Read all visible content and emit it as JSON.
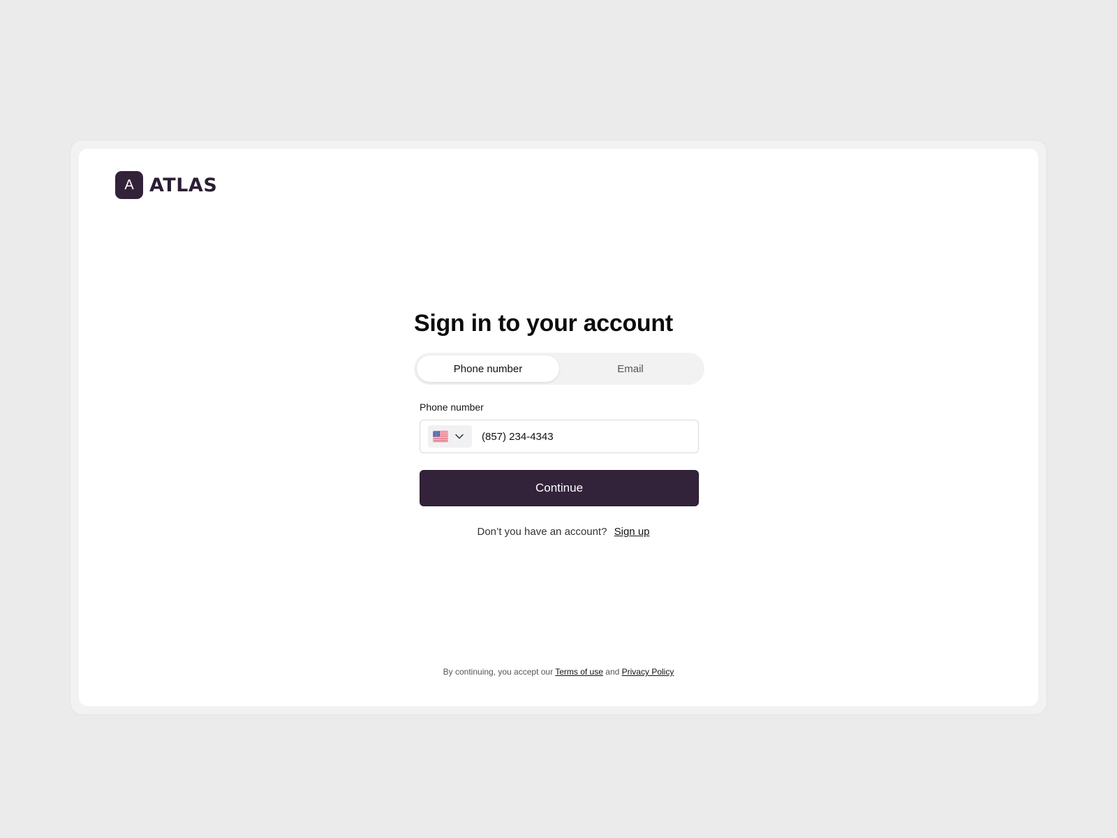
{
  "brand": {
    "logo_letter": "A",
    "name": "ATLAS",
    "color": "#33233a"
  },
  "form": {
    "title": "Sign in to your account",
    "tabs": [
      {
        "label": "Phone number",
        "active": true
      },
      {
        "label": "Email",
        "active": false
      }
    ],
    "phone_label": "Phone number",
    "country_flag": "us-flag-icon",
    "phone_value": "(857) 234-4343",
    "continue_label": "Continue"
  },
  "signup": {
    "prompt": "Don’t you have an account?",
    "link": "Sign up"
  },
  "footer": {
    "prefix": "By continuing, you accept our",
    "terms": "Terms of use",
    "conjunction": "and",
    "privacy": "Privacy Policy"
  }
}
